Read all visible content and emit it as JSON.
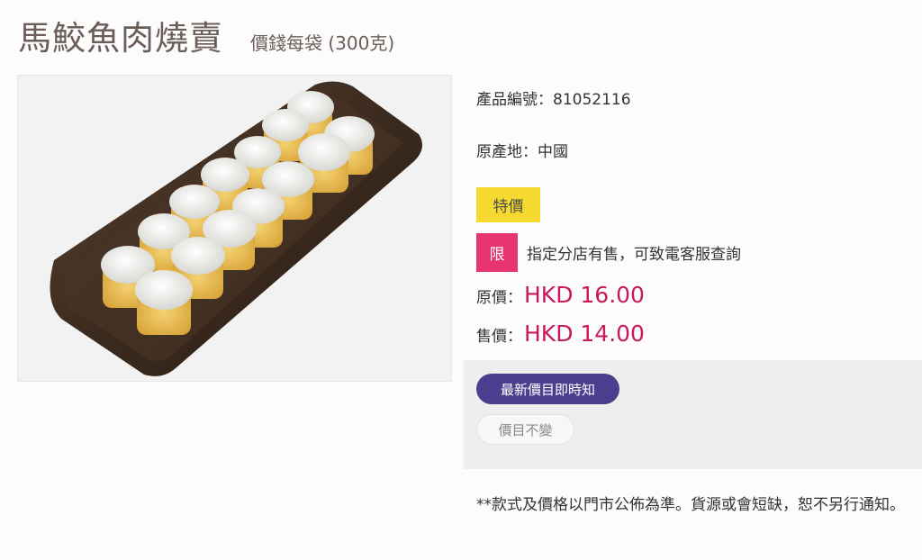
{
  "product": {
    "title": "馬鮫魚肉燒賣",
    "unit": "價錢每袋 (300克)",
    "image_alt": "fish-siu-mai-on-dark-tray",
    "code_line": "產品編號：81052116",
    "origin_line": "原產地：中國",
    "special_badge": "特價",
    "limit_badge": "限",
    "limit_text": "指定分店有售，可致電客服查詢",
    "original_price_label": "原價：",
    "original_price": "HKD 16.00",
    "sale_price_label": "售價：",
    "sale_price": "HKD 14.00"
  },
  "notify": {
    "subscribe_label": "最新價目即時知",
    "unchanged_label": "價目不變"
  },
  "disclaimer": "**款式及價格以門市公佈為準。貨源或會短缺，恕不另行通知。",
  "colors": {
    "price": "#c8195d",
    "special_badge": "#f5d92f",
    "limit_badge": "#e6356f",
    "notify_button": "#4c3e8e",
    "title": "#6b5d58"
  }
}
